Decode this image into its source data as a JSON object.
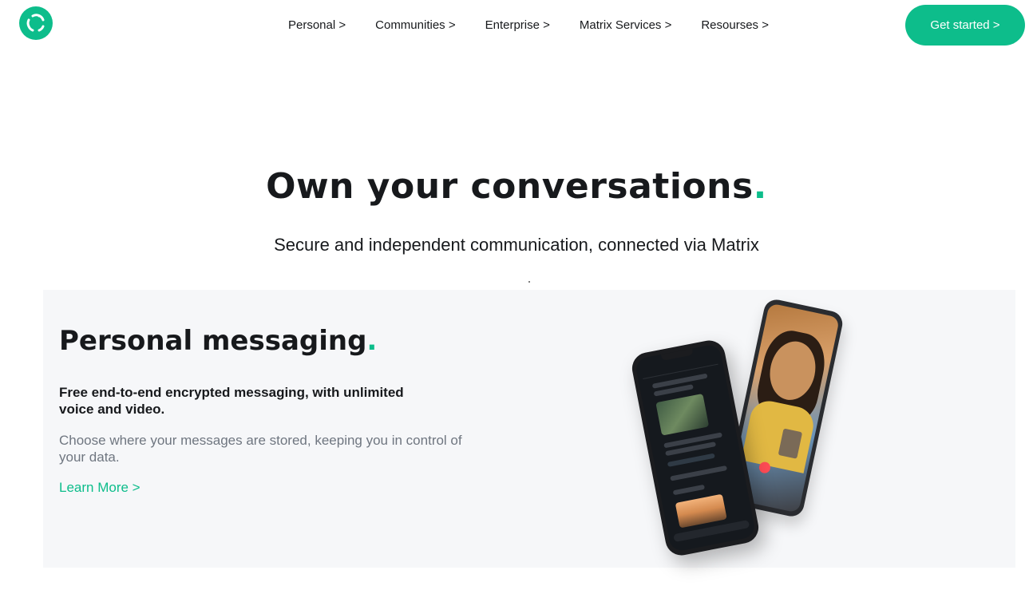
{
  "header": {
    "logo_alt": "Element",
    "nav": [
      {
        "label": "Personal >"
      },
      {
        "label": "Communities >"
      },
      {
        "label": "Enterprise >"
      },
      {
        "label": "Matrix Services >"
      },
      {
        "label": "Resourses >"
      }
    ],
    "cta_label": "Get started >"
  },
  "hero": {
    "title": "Own your conversations",
    "title_dot": ".",
    "subtitle": "Secure and independent communication, connected via Matrix"
  },
  "feature": {
    "title": "Personal messaging",
    "title_dot": ".",
    "lead": "Free end-to-end encrypted messaging, with unlimited voice and video.",
    "body": "Choose where your messages are stored, keeping you in control of your data.",
    "link": "Learn More >"
  },
  "colors": {
    "accent": "#0dbd8b",
    "text": "#17191c",
    "muted": "#6f7680",
    "panel_bg": "#f6f7f9"
  },
  "icons": {
    "logo": "element-logo-icon"
  }
}
